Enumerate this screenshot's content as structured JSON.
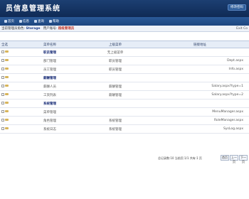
{
  "app": {
    "title": "员信息管理系统",
    "top_button": "修改密码"
  },
  "menu": [
    "首页",
    "信息",
    "查询",
    "帮助"
  ],
  "info": {
    "role_label": "当前管理员角色:",
    "role_value": "Storage",
    "user_label": "用户账号:",
    "user_value": "超级管理员",
    "right": "Exit Co"
  },
  "table": {
    "headers": [
      "全选",
      "菜单名称",
      "上级菜单",
      "链接地址"
    ],
    "rows": [
      {
        "name": "职员管理",
        "parent": "无上级菜单",
        "path": "",
        "is_parent": true
      },
      {
        "name": "部门管理",
        "parent": "职员管理",
        "path": "Dept.aspx",
        "is_parent": false
      },
      {
        "name": "员工管理",
        "parent": "职员管理",
        "path": "Info.aspx",
        "is_parent": false
      },
      {
        "name": "薪酬管理",
        "parent": "",
        "path": "",
        "is_parent": true
      },
      {
        "name": "薪酬人员",
        "parent": "薪酬管理",
        "path": "Salary.aspx?type=1",
        "is_parent": false
      },
      {
        "name": "工资列表",
        "parent": "薪酬管理",
        "path": "Salary.aspx?type=2",
        "is_parent": false
      },
      {
        "name": "系统管理",
        "parent": "",
        "path": "",
        "is_parent": true
      },
      {
        "name": "菜单管理",
        "parent": "",
        "path": "MenuManager.aspx",
        "is_parent": false
      },
      {
        "name": "角色管理",
        "parent": "系统管理",
        "path": "RoleManager.aspx",
        "is_parent": false
      },
      {
        "name": "系统日志",
        "parent": "系统管理",
        "path": "SysLog.aspx",
        "is_parent": false
      }
    ]
  },
  "pager": {
    "text": "总记录数:10 当前页:1/1 共有:1 页",
    "first": "首页",
    "prev": "上一页",
    "next": "下一页"
  }
}
